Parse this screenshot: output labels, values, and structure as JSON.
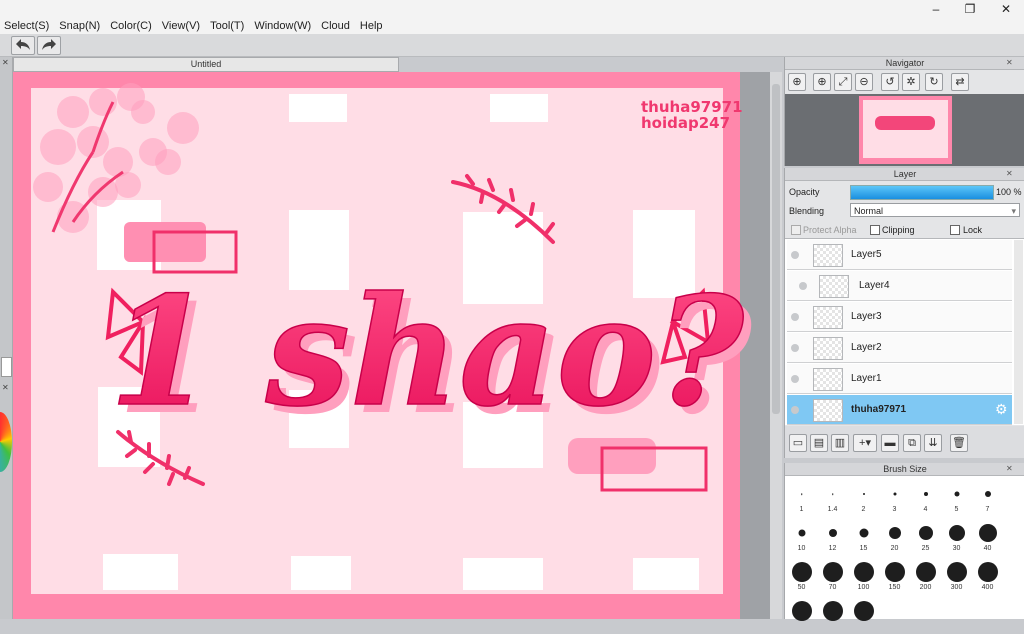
{
  "menu": [
    "Select(S)",
    "Snap(N)",
    "Color(C)",
    "View(V)",
    "Tool(T)",
    "Window(W)",
    "Cloud",
    "Help"
  ],
  "window_controls": {
    "minimize": "–",
    "maximize": "❐",
    "close": "✕"
  },
  "toolbar": {
    "undo_icon": "undo-icon",
    "redo_icon": "redo-icon"
  },
  "document": {
    "tab_title": "Untitled"
  },
  "artwork": {
    "title_text": "1 shao?",
    "watermark_line1": "thuha97971",
    "watermark_line2": "hoidap247",
    "colors": {
      "pink": "#ff87ab",
      "light_pink": "#ffdde6",
      "hot_pink": "#f0205f",
      "white": "#ffffff"
    }
  },
  "navigator": {
    "title": "Navigator",
    "buttons": [
      "zoom-in-icon",
      "zoom-in-icon",
      "fit-icon",
      "zoom-out-icon",
      "rotate-left-icon",
      "reset-rotation-icon",
      "rotate-right-icon",
      "flip-icon"
    ]
  },
  "layer_panel": {
    "title": "Layer",
    "opacity_label": "Opacity",
    "opacity_value": "100 %",
    "opacity_fraction": 1.0,
    "blending_label": "Blending",
    "blending_value": "Normal",
    "protect_alpha_label": "Protect Alpha",
    "clipping_label": "Clipping",
    "lock_label": "Lock",
    "layers": [
      {
        "name": "Layer5",
        "selected": false
      },
      {
        "name": "Layer4",
        "selected": false
      },
      {
        "name": "Layer3",
        "selected": false
      },
      {
        "name": "Layer2",
        "selected": false
      },
      {
        "name": "Layer1",
        "selected": false
      },
      {
        "name": "thuha97971",
        "selected": true
      }
    ],
    "footer_buttons": [
      "new-layer-icon",
      "new-layer-8bit-icon",
      "new-layer-1bit-icon",
      "add-icon",
      "folder-icon",
      "duplicate-icon",
      "merge-icon",
      "delete-icon"
    ]
  },
  "brush_panel": {
    "title": "Brush Size",
    "sizes": [
      "1",
      "1.4",
      "2",
      "3",
      "4",
      "5",
      "7",
      "10",
      "12",
      "15",
      "20",
      "25",
      "30",
      "40",
      "50",
      "70",
      "100",
      "150",
      "200",
      "300",
      "400",
      "",
      "",
      ""
    ]
  }
}
